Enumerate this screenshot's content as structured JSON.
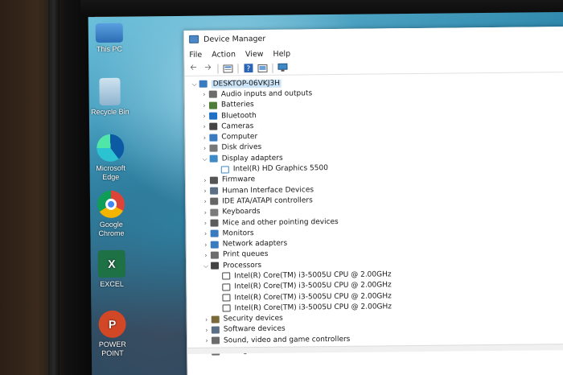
{
  "desktop": {
    "icons": [
      {
        "label": "This PC",
        "icon": "this-pc-icon",
        "color": "#3b7fc4"
      },
      {
        "label": "Recycle Bin",
        "icon": "recycle-bin-icon",
        "color": "#7aa6c8"
      },
      {
        "label": "Microsoft Edge",
        "icon": "edge-icon",
        "color": "#1d8fd6"
      },
      {
        "label": "Google Chrome",
        "icon": "chrome-icon",
        "color": "#dd4b39"
      },
      {
        "label": "EXCEL",
        "icon": "excel-icon",
        "color": "#1e7145"
      },
      {
        "label": "POWER POINT",
        "icon": "powerpoint-icon",
        "color": "#d24726"
      }
    ]
  },
  "window": {
    "title": "Device Manager",
    "menu": [
      "File",
      "Action",
      "View",
      "Help"
    ],
    "toolbar": [
      "back-arrow-icon",
      "forward-arrow-icon",
      "properties-icon",
      "help-icon",
      "update-driver-icon",
      "monitor-icon"
    ]
  },
  "tree": {
    "root": "DESKTOP-06VKJ3H",
    "categories": [
      {
        "label": "Audio inputs and outputs",
        "expanded": false,
        "icon": "speaker-icon",
        "color": "#6b6b6b"
      },
      {
        "label": "Batteries",
        "expanded": false,
        "icon": "battery-icon",
        "color": "#4e7d3a"
      },
      {
        "label": "Bluetooth",
        "expanded": false,
        "icon": "bluetooth-icon",
        "color": "#1f6fc5"
      },
      {
        "label": "Cameras",
        "expanded": false,
        "icon": "camera-icon",
        "color": "#444444"
      },
      {
        "label": "Computer",
        "expanded": false,
        "icon": "computer-icon",
        "color": "#3a7bbf"
      },
      {
        "label": "Disk drives",
        "expanded": false,
        "icon": "disk-icon",
        "color": "#777777"
      },
      {
        "label": "Display adapters",
        "expanded": true,
        "icon": "display-adapter-icon",
        "color": "#3d8ac7",
        "children": [
          "Intel(R) HD Graphics 5500"
        ]
      },
      {
        "label": "Firmware",
        "expanded": false,
        "icon": "firmware-icon",
        "color": "#555555"
      },
      {
        "label": "Human Interface Devices",
        "expanded": false,
        "icon": "hid-icon",
        "color": "#5a6f86"
      },
      {
        "label": "IDE ATA/ATAPI controllers",
        "expanded": false,
        "icon": "ide-controller-icon",
        "color": "#666666"
      },
      {
        "label": "Keyboards",
        "expanded": false,
        "icon": "keyboard-icon",
        "color": "#7a7a7a"
      },
      {
        "label": "Mice and other pointing devices",
        "expanded": false,
        "icon": "mouse-icon",
        "color": "#5c5c5c"
      },
      {
        "label": "Monitors",
        "expanded": false,
        "icon": "monitor-icon",
        "color": "#3a7bbf"
      },
      {
        "label": "Network adapters",
        "expanded": false,
        "icon": "network-adapter-icon",
        "color": "#3a7bbf"
      },
      {
        "label": "Print queues",
        "expanded": false,
        "icon": "printer-icon",
        "color": "#6d6d6d"
      },
      {
        "label": "Processors",
        "expanded": true,
        "icon": "processor-icon",
        "color": "#444444",
        "children": [
          "Intel(R) Core(TM) i3-5005U CPU @ 2.00GHz",
          "Intel(R) Core(TM) i3-5005U CPU @ 2.00GHz",
          "Intel(R) Core(TM) i3-5005U CPU @ 2.00GHz",
          "Intel(R) Core(TM) i3-5005U CPU @ 2.00GHz"
        ]
      },
      {
        "label": "Security devices",
        "expanded": false,
        "icon": "security-device-icon",
        "color": "#7a6a3a"
      },
      {
        "label": "Software devices",
        "expanded": false,
        "icon": "software-device-icon",
        "color": "#5a6f86"
      },
      {
        "label": "Sound, video and game controllers",
        "expanded": false,
        "icon": "sound-controller-icon",
        "color": "#6b6b6b"
      },
      {
        "label": "Storage controllers",
        "expanded": false,
        "icon": "storage-controller-icon",
        "color": "#6b6b6b"
      }
    ]
  }
}
